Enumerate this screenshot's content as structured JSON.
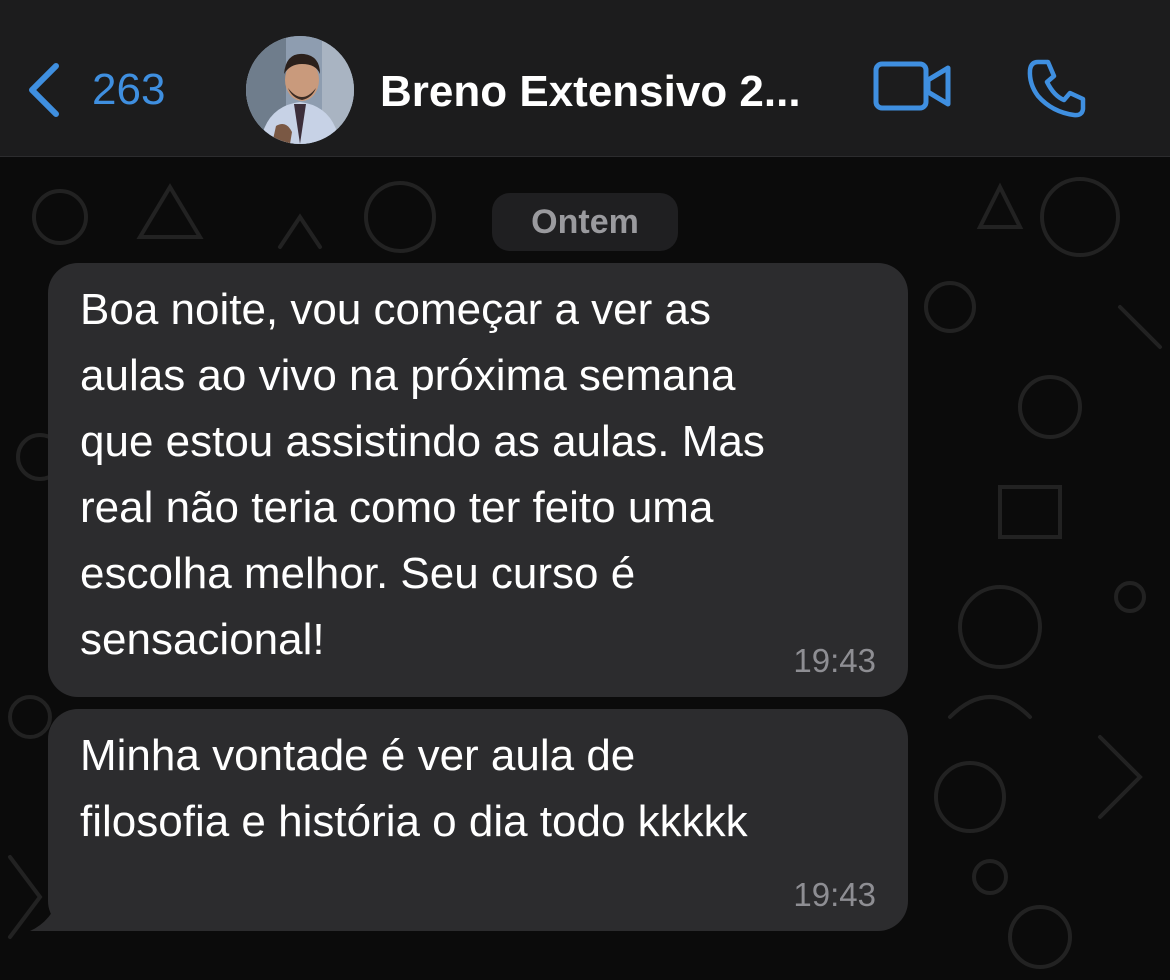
{
  "header": {
    "back_count": "263",
    "contact_name": "Breno Extensivo 2...",
    "icons": {
      "back": "chevron-left-icon",
      "video": "video-camera-icon",
      "phone": "phone-icon"
    },
    "accent": "#3f8fe0"
  },
  "chat": {
    "date_label": "Ontem",
    "messages": [
      {
        "text": "Boa noite, vou começar a ver as\naulas ao vivo na próxima semana\nque estou assistindo as aulas. Mas\nreal não teria como ter feito uma\nescolha melhor. Seu curso é\nsensacional!",
        "time": "19:43"
      },
      {
        "text": "Minha vontade é ver aula de\nfilosofia e história o dia todo kkkkk",
        "time": "19:43"
      }
    ],
    "bubble_color": "#2c2c2e",
    "background_color": "#0b0b0b"
  }
}
